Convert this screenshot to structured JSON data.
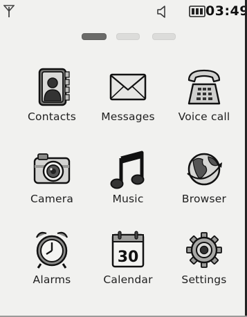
{
  "status": {
    "time": "03:49",
    "icons": [
      "signal-antenna-icon",
      "speaker-icon",
      "battery-icon"
    ]
  },
  "pager": {
    "pages": 3,
    "active": 0
  },
  "apps": [
    {
      "label": "Contacts",
      "icon": "contacts-book-icon"
    },
    {
      "label": "Messages",
      "icon": "envelope-icon"
    },
    {
      "label": "Voice call",
      "icon": "telephone-icon"
    },
    {
      "label": "Camera",
      "icon": "camera-icon"
    },
    {
      "label": "Music",
      "icon": "music-note-icon"
    },
    {
      "label": "Browser",
      "icon": "globe-icon"
    },
    {
      "label": "Alarms",
      "icon": "alarm-clock-icon"
    },
    {
      "label": "Calendar",
      "icon": "calendar-icon",
      "day": "30"
    },
    {
      "label": "Settings",
      "icon": "gear-icon"
    }
  ],
  "colors": {
    "background": "#f1f1ef",
    "ink": "#1b1b1b",
    "pager_active": "#6b6b69",
    "pager_inactive": "#dcdcda"
  }
}
